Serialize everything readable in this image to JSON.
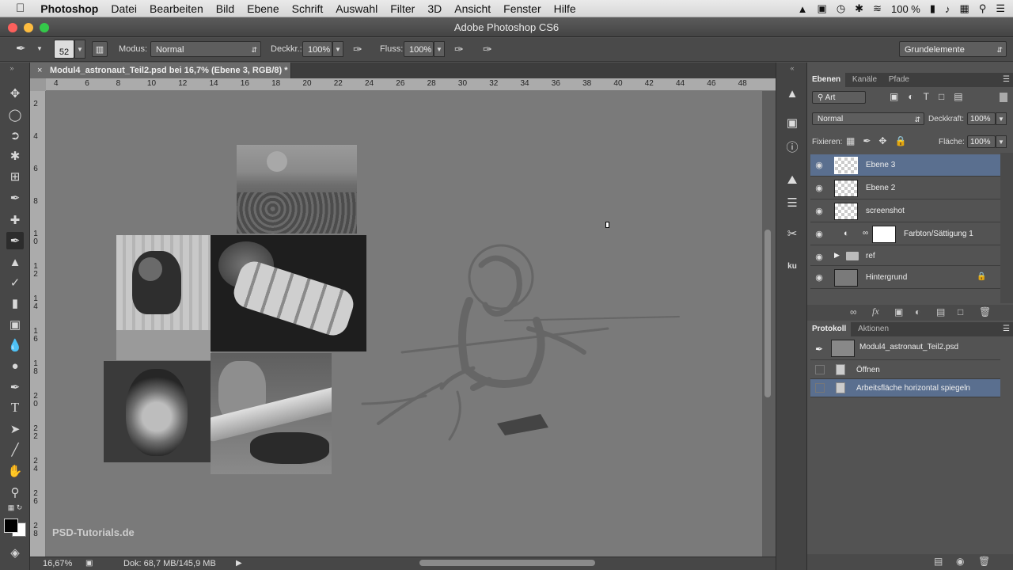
{
  "menubar": {
    "apple": "",
    "app": "Photoshop",
    "items": [
      "Datei",
      "Bearbeiten",
      "Bild",
      "Ebene",
      "Schrift",
      "Auswahl",
      "Filter",
      "3D",
      "Ansicht",
      "Fenster",
      "Hilfe"
    ],
    "battery": "100 %"
  },
  "window": {
    "title": "Adobe Photoshop CS6"
  },
  "options": {
    "brush_size": "52",
    "mode_label": "Modus:",
    "mode_value": "Normal",
    "opacity_label": "Deckkr.:",
    "opacity_value": "100%",
    "flow_label": "Fluss:",
    "flow_value": "100%",
    "workspace": "Grundelemente"
  },
  "document": {
    "tab": "Modul4_astronaut_Teil2.psd bei 16,7% (Ebene 3, RGB/8) *",
    "zoom": "16,67%",
    "doc_info": "Dok: 68,7 MB/145,9 MB"
  },
  "rulers": {
    "h": [
      "4",
      "6",
      "8",
      "10",
      "12",
      "14",
      "16",
      "18",
      "20",
      "22",
      "24",
      "26",
      "28",
      "30",
      "32",
      "34",
      "36",
      "38",
      "40",
      "42",
      "44",
      "46",
      "48"
    ],
    "v": [
      "2",
      "4",
      "6",
      "8",
      "1\n0",
      "1\n2",
      "1\n4",
      "1\n6",
      "1\n8",
      "2\n0",
      "2\n2",
      "2\n4",
      "2\n6",
      "2\n8"
    ]
  },
  "watermark": "PSD-Tutorials.de",
  "layers_panel": {
    "tabs": [
      "Ebenen",
      "Kanäle",
      "Pfade"
    ],
    "filter": "Art",
    "blend": "Normal",
    "opacity_label": "Deckkraft:",
    "opacity": "100%",
    "lock_label": "Fixieren:",
    "fill_label": "Fläche:",
    "fill": "100%",
    "layers": [
      {
        "name": "Ebene 3"
      },
      {
        "name": "Ebene 2"
      },
      {
        "name": "screenshot"
      },
      {
        "name": "Farbton/Sättigung 1"
      },
      {
        "name": "ref"
      },
      {
        "name": "Hintergrund"
      }
    ]
  },
  "history_panel": {
    "tabs": [
      "Protokoll",
      "Aktionen"
    ],
    "snapshot": "Modul4_astronaut_Teil2.psd",
    "items": [
      "Öffnen",
      "Arbeitsfläche horizontal spiegeln"
    ]
  },
  "colors": {
    "accent": "#5a6f8f",
    "canvas": "#7a7a7a"
  }
}
